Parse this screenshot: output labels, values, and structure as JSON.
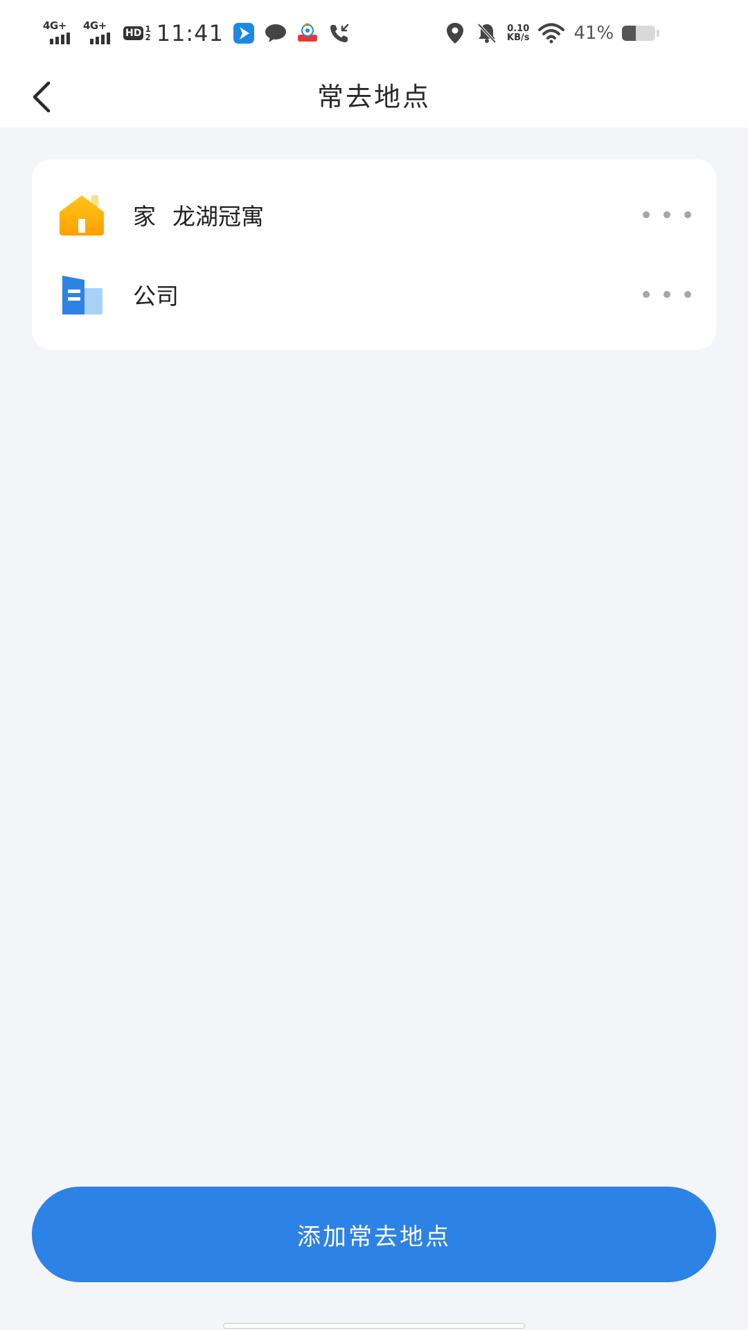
{
  "status_bar": {
    "network_1": "4G+",
    "network_2": "4G+",
    "hd_label": "HD",
    "hd_fraction_top": "1",
    "hd_fraction_bottom": "2",
    "time": "11:41",
    "speed_value": "0.10",
    "speed_unit": "KB/s",
    "battery_percent": "41%",
    "battery_level": 0.41,
    "icons": [
      "app-icon-blue-arrow",
      "chat-bubble-icon",
      "app-icon-mascot",
      "missed-call-icon",
      "location-icon",
      "bell-muted-icon",
      "wifi-icon",
      "battery-icon"
    ]
  },
  "nav": {
    "back_icon": "chevron-left-icon",
    "title": "常去地点"
  },
  "places": [
    {
      "icon": "home-icon",
      "label": "家",
      "address": "龙湖冠寓",
      "more_icon": "more-dots-icon"
    },
    {
      "icon": "company-icon",
      "label": "公司",
      "address": "",
      "more_icon": "more-dots-icon"
    }
  ],
  "footer": {
    "add_button_label": "添加常去地点"
  },
  "colors": {
    "background": "#F4F5F9",
    "card": "#FFFFFF",
    "accent": "#2C82E5",
    "home_icon": "#FFB300",
    "company_icon": "#2C82E5",
    "dots": "#A6A6A6"
  }
}
